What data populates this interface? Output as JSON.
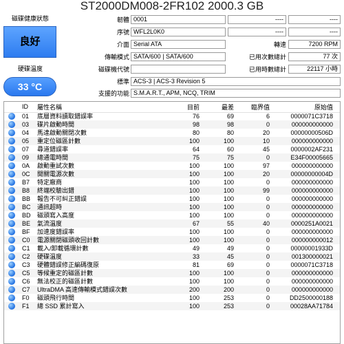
{
  "title": "ST2000DM008-2FR102 2000.3 GB",
  "health": {
    "title": "磁碟健康狀態",
    "status": "良好"
  },
  "temperature": {
    "title": "硬碟溫度",
    "value": "33 °C"
  },
  "info": {
    "firmware_label": "韌體",
    "firmware": "0001",
    "serial_label": "序號",
    "serial": "WFL2L0K0",
    "interface_label": "介面",
    "interface": "Serial ATA",
    "transfer_label": "傳輸模式",
    "transfer": "SATA/600 | SATA/600",
    "drive_letter_label": "磁碟機代號",
    "drive_letter": "",
    "standard_label": "標準",
    "standard": "ACS-3 | ACS-3 Revision 5",
    "features_label": "支援的功能",
    "features": "S.M.A.R.T., APM, NCQ, TRIM"
  },
  "right_info": {
    "blank1_left": "----",
    "blank1_right": "----",
    "blank2_left": "----",
    "blank2_right": "----",
    "rpm_label": "轉速",
    "rpm": "7200 RPM",
    "power_count_label": "已用次數總計",
    "power_count": "77 次",
    "power_hours_label": "已用時數總計",
    "power_hours": "22117 小時"
  },
  "table": {
    "headers": {
      "id": "ID",
      "name": "屬性名稱",
      "current": "目前",
      "worst": "最差",
      "threshold": "臨界值",
      "raw": "原始值"
    },
    "rows": [
      {
        "id": "01",
        "name": "底層資料讀取錯誤率",
        "current": "76",
        "worst": "69",
        "threshold": "6",
        "raw": "0000071C3718"
      },
      {
        "id": "03",
        "name": "碟片啟動時間",
        "current": "98",
        "worst": "98",
        "threshold": "0",
        "raw": "000000000000"
      },
      {
        "id": "04",
        "name": "馬達啟動關閉次數",
        "current": "80",
        "worst": "80",
        "threshold": "20",
        "raw": "00000000506D"
      },
      {
        "id": "05",
        "name": "重定位磁區計數",
        "current": "100",
        "worst": "100",
        "threshold": "10",
        "raw": "000000000000"
      },
      {
        "id": "07",
        "name": "尋道錯誤率",
        "current": "64",
        "worst": "60",
        "threshold": "45",
        "raw": "0000002AF231"
      },
      {
        "id": "09",
        "name": "總通電時間",
        "current": "75",
        "worst": "75",
        "threshold": "0",
        "raw": "E34F00005665"
      },
      {
        "id": "0A",
        "name": "啟動重試次數",
        "current": "100",
        "worst": "100",
        "threshold": "97",
        "raw": "000000000000"
      },
      {
        "id": "0C",
        "name": "開關電源次數",
        "current": "100",
        "worst": "100",
        "threshold": "20",
        "raw": "00000000004D"
      },
      {
        "id": "B7",
        "name": "特定廠商",
        "current": "100",
        "worst": "100",
        "threshold": "0",
        "raw": "000000000000"
      },
      {
        "id": "B8",
        "name": "終端校驗出錯",
        "current": "100",
        "worst": "100",
        "threshold": "99",
        "raw": "000000000000"
      },
      {
        "id": "BB",
        "name": "報告不可糾正錯誤",
        "current": "100",
        "worst": "100",
        "threshold": "0",
        "raw": "000000000000"
      },
      {
        "id": "BC",
        "name": "通訊超時",
        "current": "100",
        "worst": "100",
        "threshold": "0",
        "raw": "000000000000"
      },
      {
        "id": "BD",
        "name": "磁頭寫入高度",
        "current": "100",
        "worst": "100",
        "threshold": "0",
        "raw": "000000000000"
      },
      {
        "id": "BE",
        "name": "氣流溫度",
        "current": "67",
        "worst": "55",
        "threshold": "40",
        "raw": "0000251A0021"
      },
      {
        "id": "BF",
        "name": "加速度錯誤率",
        "current": "100",
        "worst": "100",
        "threshold": "0",
        "raw": "000000000000"
      },
      {
        "id": "C0",
        "name": "電源關閉磁頭收回計數",
        "current": "100",
        "worst": "100",
        "threshold": "0",
        "raw": "000000000012"
      },
      {
        "id": "C1",
        "name": "載入/卸載循環計數",
        "current": "49",
        "worst": "49",
        "threshold": "0",
        "raw": "00000001933D"
      },
      {
        "id": "C2",
        "name": "硬碟溫度",
        "current": "33",
        "worst": "45",
        "threshold": "0",
        "raw": "001300000021"
      },
      {
        "id": "C3",
        "name": "硬體錯誤修正編碼復原",
        "current": "81",
        "worst": "69",
        "threshold": "0",
        "raw": "0000071C3718"
      },
      {
        "id": "C5",
        "name": "等候重定的磁區計數",
        "current": "100",
        "worst": "100",
        "threshold": "0",
        "raw": "000000000000"
      },
      {
        "id": "C6",
        "name": "無法校正的磁區計數",
        "current": "100",
        "worst": "100",
        "threshold": "0",
        "raw": "000000000000"
      },
      {
        "id": "C7",
        "name": "UltraDMA 高速傳輸模式錯誤次數",
        "current": "200",
        "worst": "200",
        "threshold": "0",
        "raw": "000000000000"
      },
      {
        "id": "F0",
        "name": "磁頭飛行時間",
        "current": "100",
        "worst": "253",
        "threshold": "0",
        "raw": "DD2500000188"
      },
      {
        "id": "F1",
        "name": "總 SSD 累計寫入",
        "current": "100",
        "worst": "253",
        "threshold": "0",
        "raw": "00028AA71784"
      }
    ]
  }
}
